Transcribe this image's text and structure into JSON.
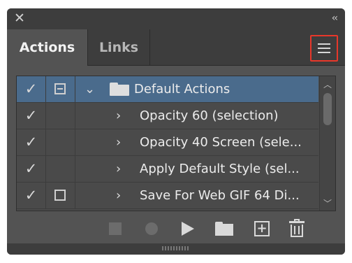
{
  "titlebar": {
    "close_glyph": "✕",
    "collapse_glyph": "‹‹"
  },
  "tabs": [
    {
      "label": "Actions",
      "active": true
    },
    {
      "label": "Links",
      "active": false
    }
  ],
  "panel_menu": {
    "icon": "hamburger-menu-icon",
    "highlight_color": "#e8372a"
  },
  "actions_list": {
    "selected_row": 0,
    "rows": [
      {
        "label": "Default Actions",
        "checked": true,
        "dialog": "partial",
        "expanded": true,
        "is_set": true
      },
      {
        "label": "Opacity 60 (selection)",
        "checked": true,
        "dialog": "none",
        "expanded": false,
        "is_set": false
      },
      {
        "label": "Opacity 40 Screen (sele...",
        "checked": true,
        "dialog": "none",
        "expanded": false,
        "is_set": false
      },
      {
        "label": "Apply Default Style (sel...",
        "checked": true,
        "dialog": "none",
        "expanded": false,
        "is_set": false
      },
      {
        "label": "Save For Web GIF 64 Di...",
        "checked": true,
        "dialog": "on",
        "expanded": false,
        "is_set": false
      }
    ]
  },
  "toolbar": {
    "buttons": [
      "stop-playing-icon",
      "begin-recording-icon",
      "play-selection-icon",
      "create-new-set-icon",
      "create-new-action-icon",
      "delete-selection-icon"
    ]
  },
  "colors": {
    "panel_bg": "#535353",
    "header_bg": "#3d3d3d",
    "selection": "#4a6b8c"
  }
}
